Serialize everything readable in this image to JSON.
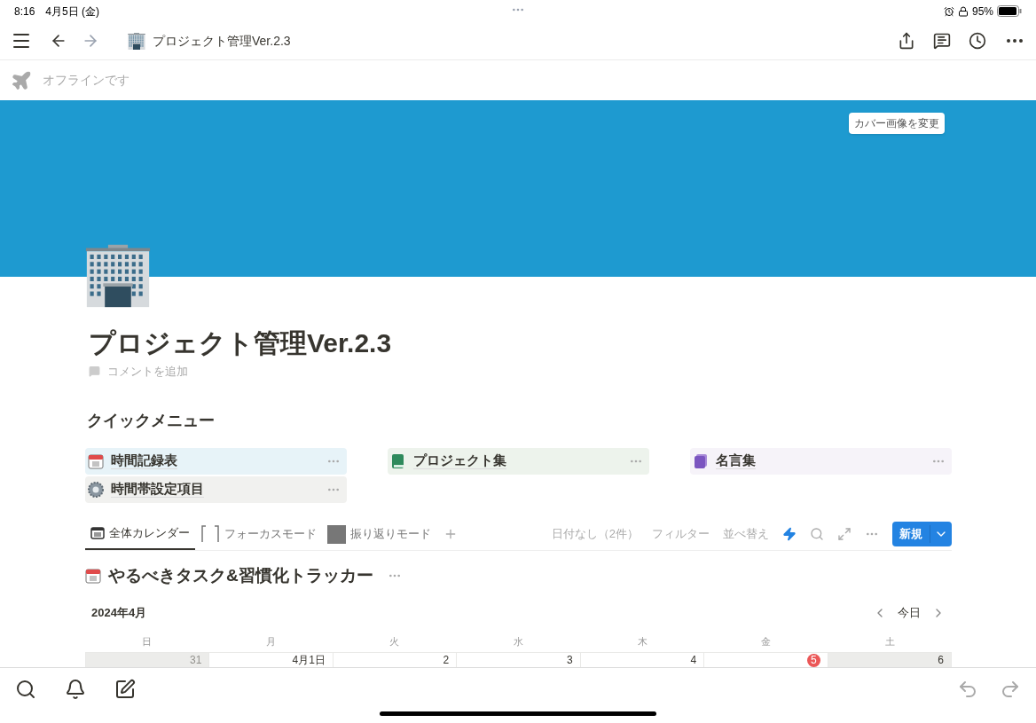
{
  "status_bar": {
    "time": "8:16",
    "date": "4月5日 (金)",
    "battery": "95%"
  },
  "nav": {
    "title": "プロジェクト管理Ver.2.3"
  },
  "offline": {
    "text": "オフラインです"
  },
  "cover": {
    "change_button": "カバー画像を変更"
  },
  "page": {
    "title": "プロジェクト管理Ver.2.3",
    "comment": "コメントを追加"
  },
  "quick_menu": {
    "heading": "クイックメニュー",
    "items": [
      {
        "label": "時間記録表",
        "kind": "calendar",
        "color": "#e7f3f8"
      },
      {
        "label": "プロジェクト集",
        "kind": "green-book",
        "color": "#edf3ec"
      },
      {
        "label": "名言集",
        "kind": "purple-book",
        "color": "#f6f3f9"
      },
      {
        "label": "時間帯設定項目",
        "kind": "gear",
        "color": "#f1f1ef"
      }
    ]
  },
  "views": {
    "tabs": [
      {
        "label": "全体カレンダー",
        "kind": "calendar",
        "selected": true
      },
      {
        "label": "フォーカスモード",
        "kind": "bracket",
        "selected": false
      },
      {
        "label": "振り返りモード",
        "kind": "square",
        "selected": false
      }
    ],
    "no_date": "日付なし（2件）",
    "filter": "フィルター",
    "sort": "並べ替え",
    "new_button": "新規"
  },
  "database": {
    "title": "やるべきタスク&習慣化トラッカー"
  },
  "calendar": {
    "month": "2024年4月",
    "today_button": "今日",
    "weekdays": [
      "日",
      "月",
      "火",
      "水",
      "木",
      "金",
      "土"
    ],
    "days": [
      {
        "label": "31",
        "weekend": true,
        "outside_month": true,
        "today": false
      },
      {
        "label": "4月1日",
        "weekend": false,
        "outside_month": false,
        "today": false
      },
      {
        "label": "2",
        "weekend": false,
        "outside_month": false,
        "today": false
      },
      {
        "label": "3",
        "weekend": false,
        "outside_month": false,
        "today": false
      },
      {
        "label": "4",
        "weekend": false,
        "outside_month": false,
        "today": false
      },
      {
        "label": "5",
        "weekend": false,
        "outside_month": false,
        "today": true
      },
      {
        "label": "6",
        "weekend": true,
        "outside_month": false,
        "today": false
      }
    ]
  }
}
